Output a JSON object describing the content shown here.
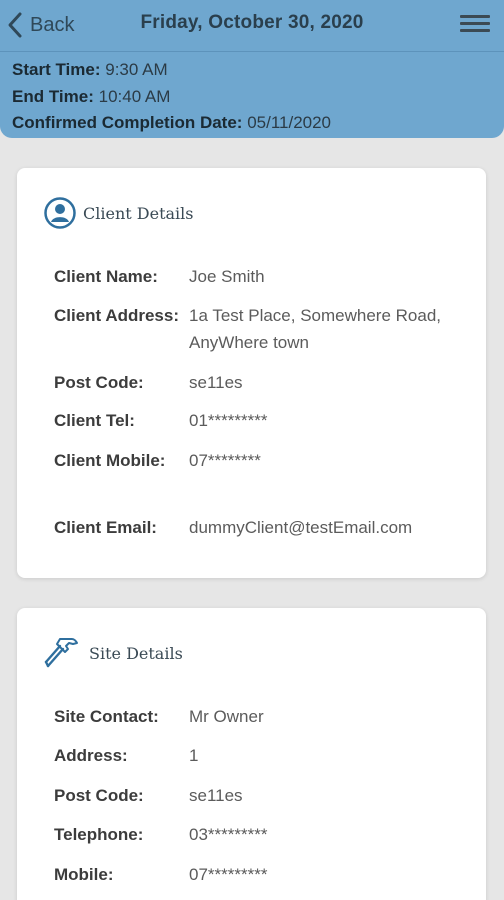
{
  "header": {
    "back_label": "Back",
    "title": "Friday, October 30, 2020"
  },
  "summary": {
    "start_label": "Start Time:",
    "start_value": "9:30 AM",
    "end_label": "End Time:",
    "end_value": "10:40 AM",
    "completion_label": "Confirmed Completion Date:",
    "completion_value": "05/11/2020"
  },
  "client": {
    "heading": "Client Details",
    "fields": [
      {
        "label": "Client Name:",
        "value": "Joe Smith"
      },
      {
        "label": "Client Address:",
        "value": "1a Test Place, Somewhere Road, AnyWhere town"
      },
      {
        "label": "Post Code:",
        "value": "se11es"
      },
      {
        "label": "Client Tel:",
        "value": "01*********"
      },
      {
        "label": "Client Mobile:",
        "value": "07********"
      },
      {
        "label": "Client Email:",
        "value": "dummyClient@testEmail.com"
      }
    ]
  },
  "site": {
    "heading": "Site Details",
    "fields": [
      {
        "label": "Site Contact:",
        "value": "Mr Owner"
      },
      {
        "label": "Address:",
        "value": "1"
      },
      {
        "label": "Post Code:",
        "value": "se11es"
      },
      {
        "label": "Telephone:",
        "value": "03*********"
      },
      {
        "label": "Mobile:",
        "value": "07*********"
      }
    ]
  },
  "colors": {
    "header_bg": "#6fa7cf",
    "page_bg": "#e6e6e6",
    "icon_blue": "#2f6f9e"
  },
  "icons": [
    "chevron-left-icon",
    "hamburger-menu-icon",
    "user-circle-icon",
    "hammer-icon"
  ]
}
